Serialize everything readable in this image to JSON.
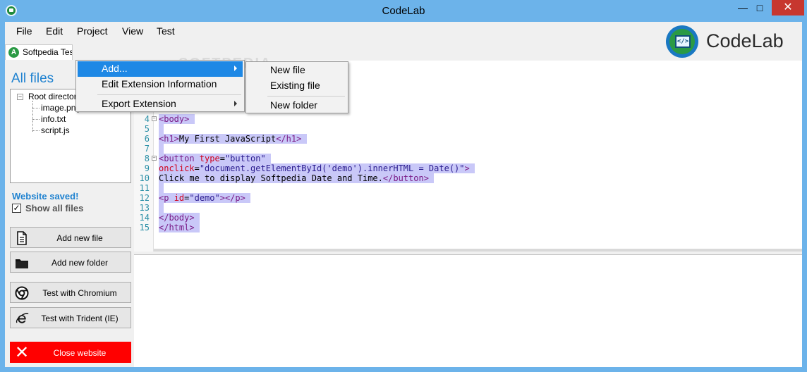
{
  "window": {
    "title": "CodeLab",
    "minimize": "—",
    "maximize": "□",
    "close": "✕"
  },
  "menubar": {
    "items": [
      "File",
      "Edit",
      "Project",
      "View",
      "Test"
    ]
  },
  "logo": {
    "text": "CodeLab",
    "glyph": "</>"
  },
  "tab": {
    "icon_letter": "A",
    "label": "Softpedia Test"
  },
  "watermark": "SOFTPEDIA",
  "sidebar": {
    "title": "All files",
    "tree": {
      "root": "Root directory",
      "children": [
        "image.png",
        "info.txt",
        "script.js"
      ]
    },
    "status": "Website saved!",
    "show_all": {
      "label": "Show all files",
      "checked": true,
      "mark": "✓"
    },
    "buttons": {
      "add_file": "Add new file",
      "add_folder": "Add new folder",
      "chromium": "Test with Chromium",
      "trident": "Test with Trident (IE)",
      "close": "Close website"
    },
    "close_icon": "✕"
  },
  "editor": {
    "lines": [
      {
        "n": "4",
        "fold": "−",
        "parts": [
          [
            "tg",
            "<body>"
          ]
        ]
      },
      {
        "n": "5",
        "parts": []
      },
      {
        "n": "6",
        "parts": [
          [
            "tg",
            "<h1>"
          ],
          [
            "pl",
            "My First JavaScript"
          ],
          [
            "tg",
            "</h1>"
          ]
        ]
      },
      {
        "n": "7",
        "parts": []
      },
      {
        "n": "8",
        "fold": "−",
        "parts": [
          [
            "tg",
            "<button "
          ],
          [
            "at",
            "type"
          ],
          [
            "pl",
            "="
          ],
          [
            "st",
            "\"button\""
          ]
        ]
      },
      {
        "n": "9",
        "parts": [
          [
            "at",
            "onclick"
          ],
          [
            "pl",
            "="
          ],
          [
            "st",
            "\"document.getElementById('demo').innerHTML = Date()\""
          ],
          [
            "tg",
            ">"
          ]
        ]
      },
      {
        "n": "10",
        "parts": [
          [
            "pl",
            "Click me to display Softpedia Date and Time."
          ],
          [
            "tg",
            "</button>"
          ]
        ]
      },
      {
        "n": "11",
        "parts": []
      },
      {
        "n": "12",
        "parts": [
          [
            "tg",
            "<p "
          ],
          [
            "at",
            "id"
          ],
          [
            "pl",
            "="
          ],
          [
            "st",
            "\"demo\""
          ],
          [
            "tg",
            "></p>"
          ]
        ]
      },
      {
        "n": "13",
        "parts": []
      },
      {
        "n": "14",
        "parts": [
          [
            "tg",
            "</body>"
          ]
        ]
      },
      {
        "n": "15",
        "parts": [
          [
            "tg",
            "</html>"
          ]
        ]
      }
    ]
  },
  "project_menu": {
    "items": [
      {
        "label": "Add...",
        "submenu": true,
        "highlighted": true
      },
      {
        "label": "Edit Extension Information",
        "submenu": false
      },
      {
        "label": "Export Extension",
        "submenu": true
      }
    ]
  },
  "add_menu": {
    "items": [
      "New file",
      "Existing file",
      "New folder"
    ]
  },
  "colors": {
    "accent": "#1f82d0",
    "titlebar": "#6cb3ea",
    "close_button": "#ff0000",
    "selection": "#c9c8f8"
  }
}
